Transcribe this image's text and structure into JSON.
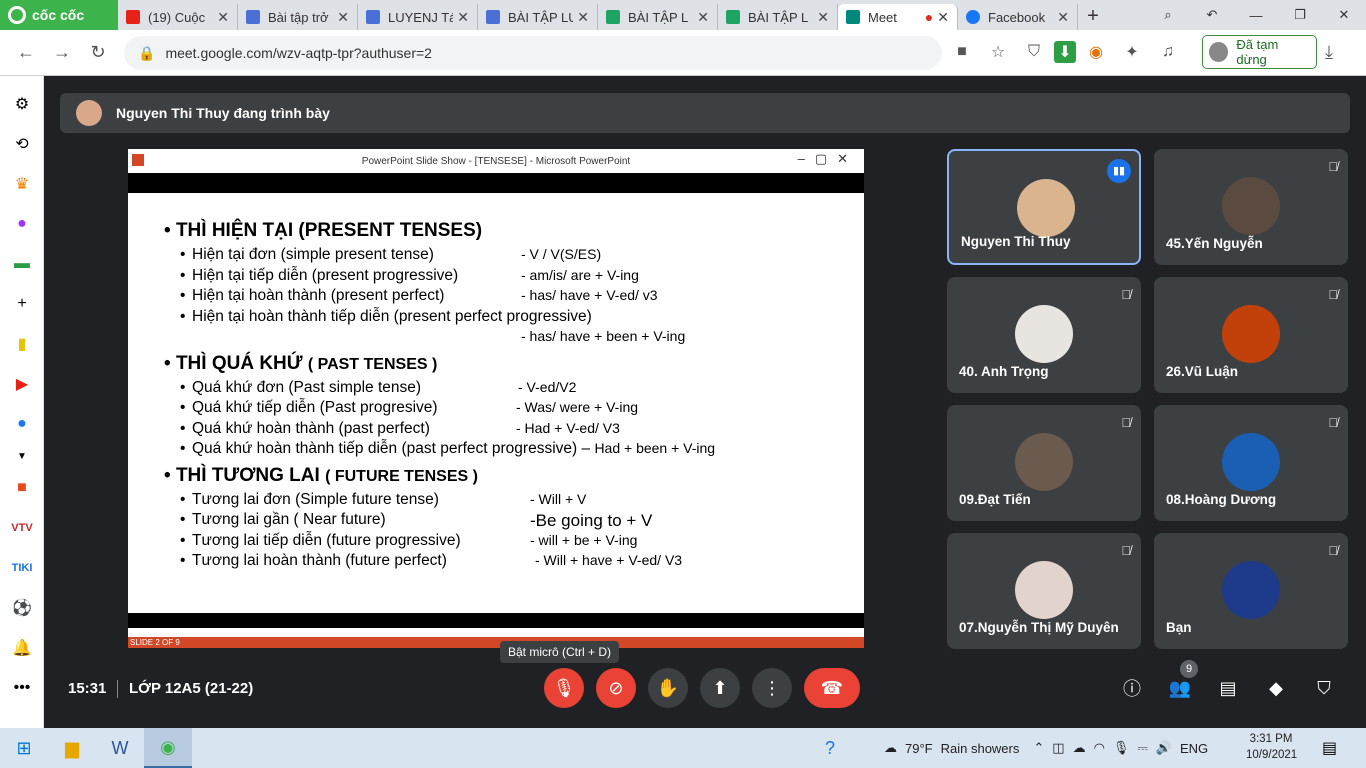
{
  "browser": {
    "brand": "cốc cốc",
    "tabs": [
      {
        "title": "(19) Cuộc",
        "color": "#e62117"
      },
      {
        "title": "Bài tập trở",
        "color": "#4a6fd6"
      },
      {
        "title": "LUYENJ Tá",
        "color": "#4a6fd6"
      },
      {
        "title": "BÀI TẬP LU",
        "color": "#4a6fd6"
      },
      {
        "title": "BÀI TẬP L",
        "color": "#1fa463"
      },
      {
        "title": "BÀI TẬP L",
        "color": "#1fa463"
      },
      {
        "title": "Meet",
        "color": "#00897b"
      },
      {
        "title": "Facebook",
        "color": "#1877f2"
      }
    ],
    "url": "meet.google.com/wzv-aqtp-tpr?authuser=2",
    "paused_label": "Đã tạm dừng"
  },
  "meet": {
    "presenting_banner": "Nguyen Thi Thuy đang trình bày",
    "slide_window_title": "PowerPoint Slide Show - [TENSESE] - Microsoft PowerPoint",
    "slide_footer": "SLIDE 2 OF 9",
    "slide": {
      "h_present": "THÌ HIỆN TẠI (PRESENT TENSES)",
      "present": [
        {
          "name": "Hiện tại đơn (simple present tense)",
          "formula": "- V / V(S/ES)"
        },
        {
          "name": "Hiện tại tiếp diễn (present progressive)",
          "formula": "- am/is/ are + V-ing"
        },
        {
          "name": "Hiện tại hoàn thành (present perfect)",
          "formula": "- has/ have + V-ed/ v3"
        },
        {
          "name": "Hiện tại hoàn thành tiếp diễn (present perfect progressive)",
          "formula": ""
        }
      ],
      "present_extra": "- has/ have + been + V-ing",
      "h_past_a": "THÌ QUÁ KHỨ",
      "h_past_b": "( PAST TENSES )",
      "past": [
        {
          "name": "Quá khứ đơn (Past simple tense)",
          "formula": "- V-ed/V2"
        },
        {
          "name": "Quá khứ tiếp diễn (Past progresive)",
          "formula": "- Was/ were + V-ing"
        },
        {
          "name": "Quá khứ hoàn thành (past perfect)",
          "formula": "- Had + V-ed/ V3"
        },
        {
          "name": "Quá khứ hoàn thành tiếp diễn (past perfect progressive) –",
          "formula": "Had + been + V-ing"
        }
      ],
      "h_future_a": "THÌ TƯƠNG LAI",
      "h_future_b": "( FUTURE TENSES )",
      "future": [
        {
          "name": "Tương lai đơn (Simple future tense)",
          "formula": "- Will + V"
        },
        {
          "name": "Tương lai gần ( Near future)",
          "formula": "-Be going to + V"
        },
        {
          "name": "Tương lai tiếp diễn (future progressive)",
          "formula": "- will + be + V-ing"
        },
        {
          "name": "Tương lai hoàn thành (future perfect)",
          "formula": "- Will + have + V-ed/ V3"
        }
      ]
    },
    "participants": [
      {
        "name": "Nguyen Thi Thuy",
        "speaking": true,
        "avatar_color": "#d9b48f"
      },
      {
        "name": "45.Yến Nguyễn",
        "speaking": false,
        "avatar_color": "#5a4a40"
      },
      {
        "name": "40. Anh Trọng",
        "speaking": false,
        "avatar_color": "#e8e4e0"
      },
      {
        "name": "26.Vũ Luận",
        "speaking": false,
        "avatar_color": "#c2400a"
      },
      {
        "name": "09.Đạt Tiến",
        "speaking": false,
        "avatar_color": "#6b5a4e"
      },
      {
        "name": "08.Hoàng Dương",
        "speaking": false,
        "avatar_color": "#1a5fb4"
      },
      {
        "name": "07.Nguyễn Thị Mỹ Duyên",
        "speaking": false,
        "avatar_color": "#e2d4cc"
      },
      {
        "name": "Bạn",
        "speaking": false,
        "avatar_color": "#1e3a8a"
      }
    ],
    "tooltip": "Bật micrô (Ctrl + D)",
    "time": "15:31",
    "room": "LỚP 12A5 (21-22)",
    "people_count": "9"
  },
  "taskbar": {
    "weather": "79°F",
    "weather_text": "Rain showers",
    "lang": "ENG",
    "time": "3:31 PM",
    "date": "10/9/2021"
  }
}
